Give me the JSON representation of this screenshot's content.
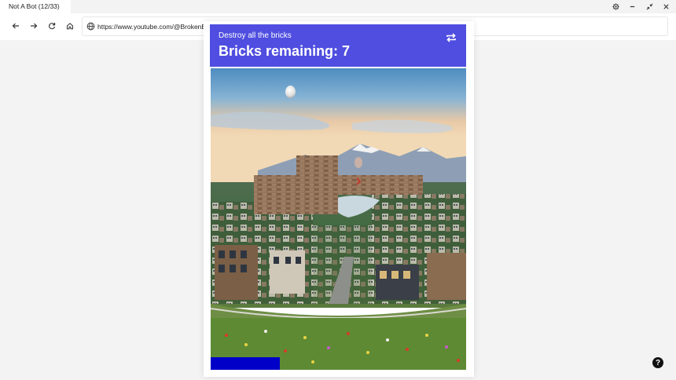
{
  "tab": {
    "title": "Not A Bot (12/33)"
  },
  "window_controls": [
    "settings-icon",
    "minimize-icon",
    "restore-icon",
    "close-icon"
  ],
  "nav": {
    "icons": [
      "back-arrow-icon",
      "forward-arrow-icon",
      "reload-icon",
      "home-icon"
    ]
  },
  "address": {
    "url": "https://www.youtube.com/@BrokenBox"
  },
  "captcha": {
    "instruction": "Destroy all the bricks",
    "status": "Bricks remaining: 7",
    "header_color": "#4f4ee0",
    "paddle_color": "#0000c8"
  },
  "help": {
    "label": "?"
  }
}
